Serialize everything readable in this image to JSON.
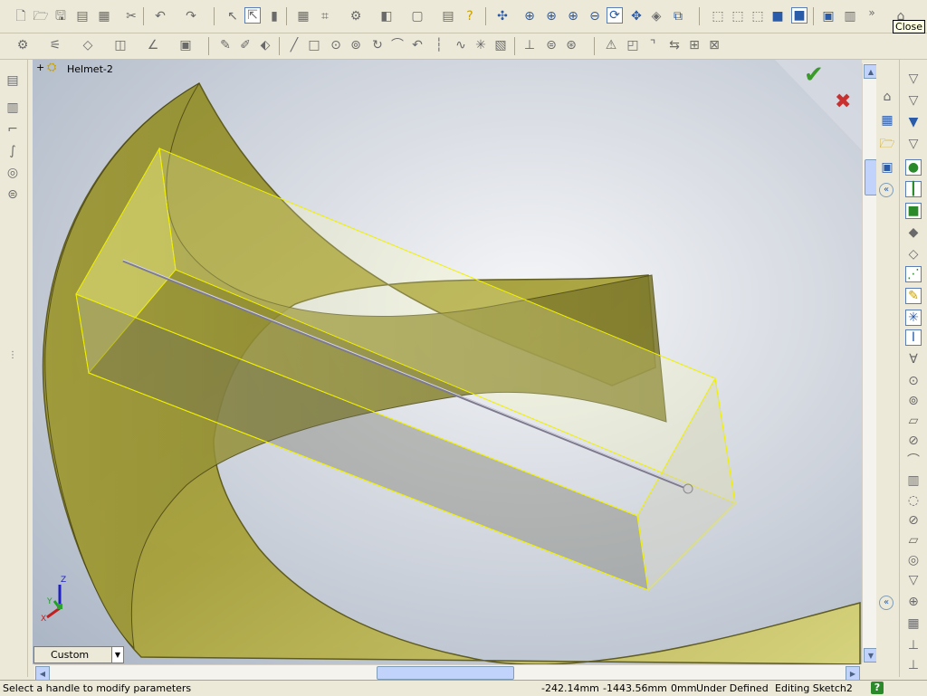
{
  "app": {
    "close_tooltip": "Close"
  },
  "feature_tree": {
    "expander": "+",
    "part_name": "Helmet-2"
  },
  "confirm": {
    "ok_symbol": "✔",
    "cancel_symbol": "✖"
  },
  "view": {
    "orientation_label": "Custom",
    "axis_labels": {
      "x": "X",
      "y": "Y",
      "z": "Z"
    }
  },
  "status": {
    "message": "Select a handle to modify parameters",
    "coord_x": "-242.14mm",
    "coord_y": "-1443.56mm",
    "coord_z": "0mm",
    "sketch_state": "Under Defined",
    "editing": "Editing Sketch2",
    "help_symbol": "?"
  },
  "colors": {
    "model_fill": "#a8a13a",
    "box_edge": "#f0f000",
    "background": "#c8ced8",
    "accent": "#316ac5"
  }
}
